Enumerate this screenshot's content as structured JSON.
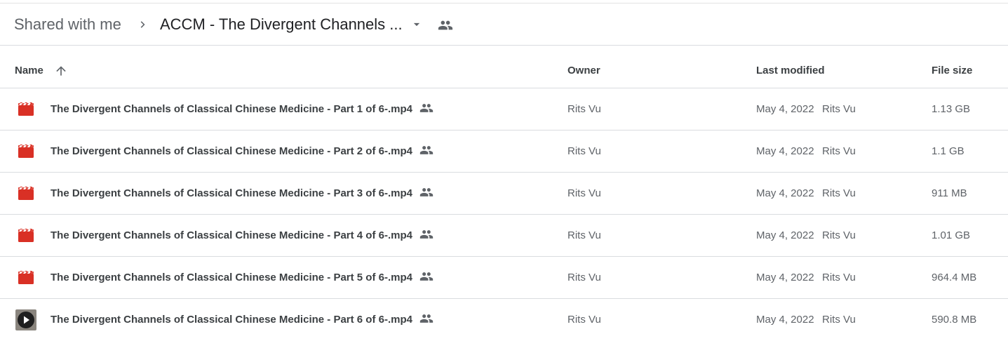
{
  "breadcrumb": {
    "root": "Shared with me",
    "current": "ACCM - The Divergent Channels ...",
    "separator_icon": "chevron-right-icon",
    "dropdown_icon": "arrow-drop-down-icon",
    "shared_icon": "people-icon"
  },
  "columns": {
    "name": "Name",
    "owner": "Owner",
    "last_modified": "Last modified",
    "file_size": "File size",
    "sort_icon": "arrow-upward-icon"
  },
  "colors": {
    "video_icon": "#d93025",
    "text_primary": "#3c4043",
    "text_secondary": "#5f6368",
    "divider": "#dadce0"
  },
  "files": [
    {
      "name": "The Divergent Channels of Classical Chinese Medicine - Part 1 of 6-.mp4",
      "owner": "Rits Vu",
      "modified": "May 4, 2022",
      "modified_by": "Rits Vu",
      "size": "1.13 GB",
      "icon": "video-file-icon"
    },
    {
      "name": "The Divergent Channels of Classical Chinese Medicine - Part 2 of 6-.mp4",
      "owner": "Rits Vu",
      "modified": "May 4, 2022",
      "modified_by": "Rits Vu",
      "size": "1.1 GB",
      "icon": "video-file-icon"
    },
    {
      "name": "The Divergent Channels of Classical Chinese Medicine - Part 3 of 6-.mp4",
      "owner": "Rits Vu",
      "modified": "May 4, 2022",
      "modified_by": "Rits Vu",
      "size": "911 MB",
      "icon": "video-file-icon"
    },
    {
      "name": "The Divergent Channels of Classical Chinese Medicine - Part 4 of 6-.mp4",
      "owner": "Rits Vu",
      "modified": "May 4, 2022",
      "modified_by": "Rits Vu",
      "size": "1.01 GB",
      "icon": "video-file-icon"
    },
    {
      "name": "The Divergent Channels of Classical Chinese Medicine - Part 5 of 6-.mp4",
      "owner": "Rits Vu",
      "modified": "May 4, 2022",
      "modified_by": "Rits Vu",
      "size": "964.4 MB",
      "icon": "video-file-icon"
    },
    {
      "name": "The Divergent Channels of Classical Chinese Medicine - Part 6 of 6-.mp4",
      "owner": "Rits Vu",
      "modified": "May 4, 2022",
      "modified_by": "Rits Vu",
      "size": "590.8 MB",
      "icon": "video-thumbnail-icon"
    }
  ]
}
